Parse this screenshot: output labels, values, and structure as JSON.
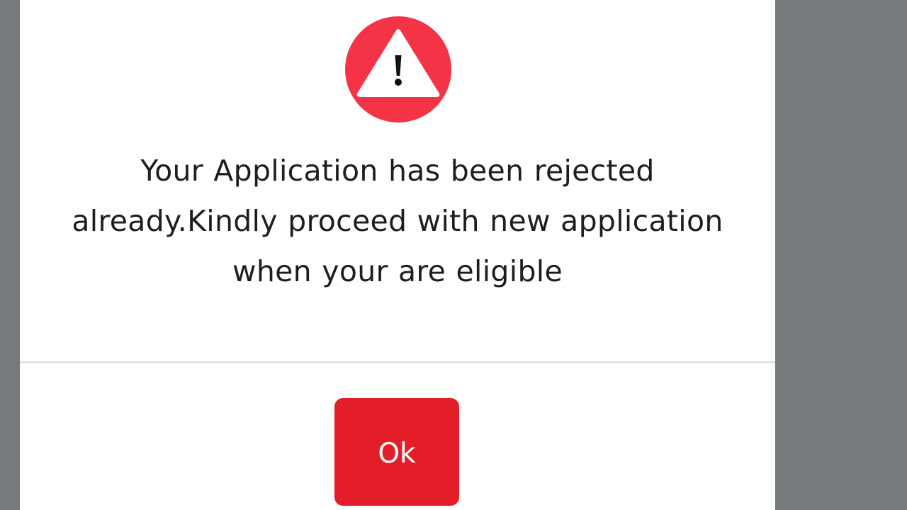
{
  "dialog": {
    "icon": "warning-triangle-icon",
    "message": "Your Application has been rejected already.Kindly proceed with new application when your are eligible",
    "ok_label": "Ok"
  },
  "colors": {
    "backdrop": "#767a7d",
    "dialog_background": "#ffffff",
    "alert_circle": "#f43346",
    "button": "#e41e28",
    "text": "#1e1e1e",
    "divider": "#e2e2e2"
  }
}
